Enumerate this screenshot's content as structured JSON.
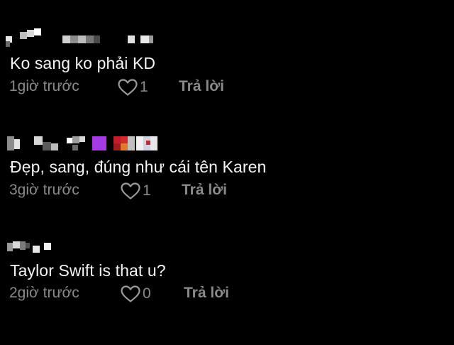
{
  "comments": [
    {
      "username_pixelated": true,
      "text": "Ko sang ko phải KD",
      "time": "1giờ trước",
      "likes": "1",
      "like_icon": "heart-outline-icon",
      "reply_label": "Trả lời"
    },
    {
      "username_pixelated": true,
      "text": "Đẹp, sang, đúng như cái tên Karen",
      "time": "3giờ trước",
      "likes": "1",
      "like_icon": "heart-outline-icon",
      "reply_label": "Trả lời"
    },
    {
      "username_pixelated": true,
      "text": "Taylor Swift is that u?",
      "time": "2giờ trước",
      "likes": "0",
      "like_icon": "heart-outline-icon",
      "reply_label": "Trả lời"
    }
  ],
  "colors": {
    "background": "#000000",
    "text": "#f4f4f4",
    "muted": "#8a8a8a"
  }
}
